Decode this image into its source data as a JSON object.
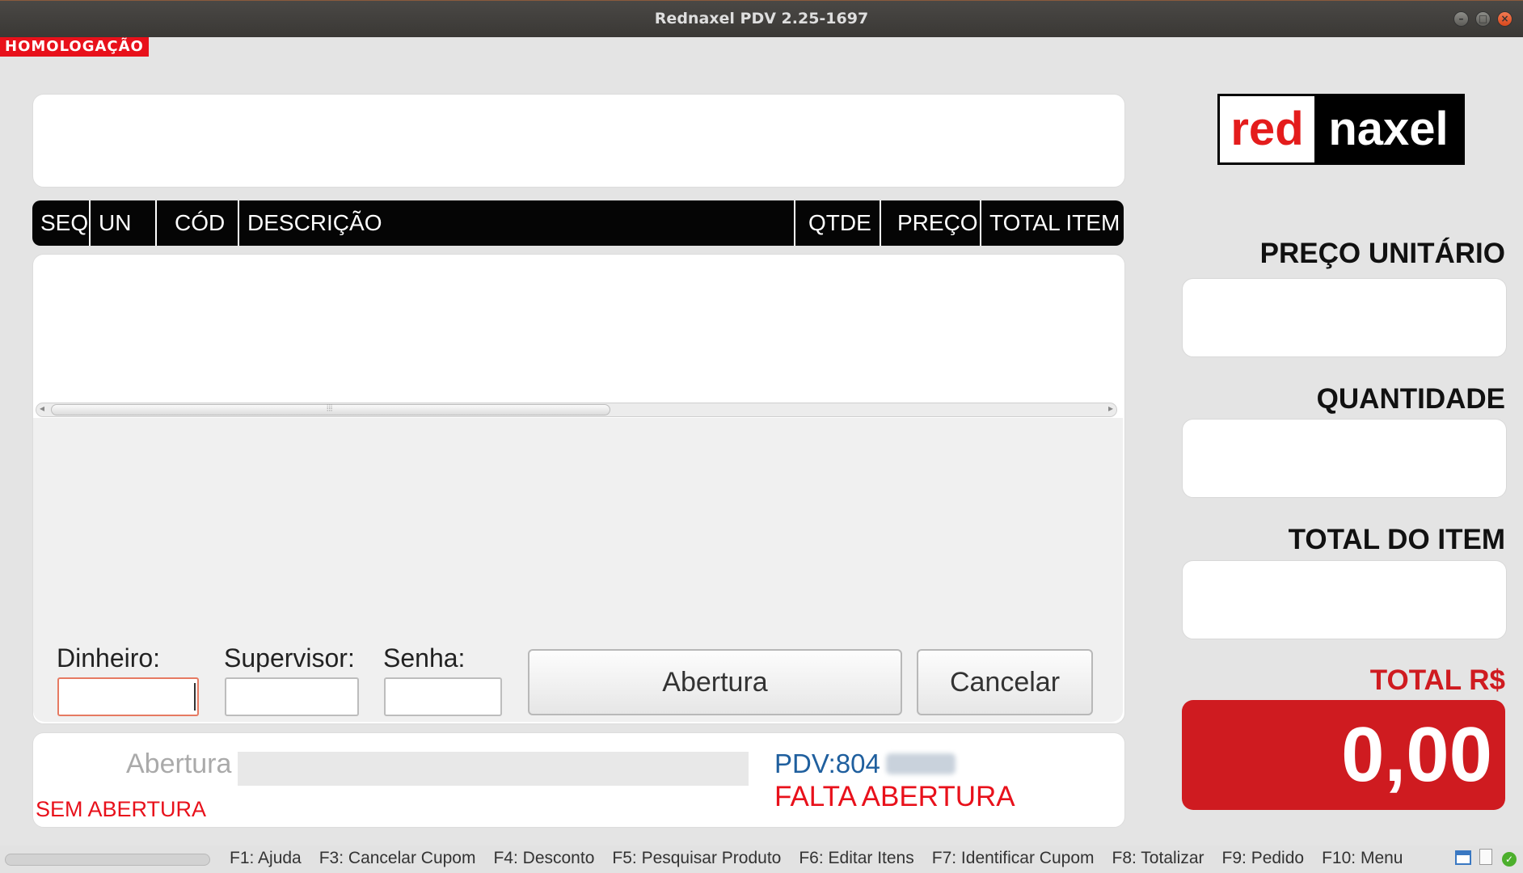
{
  "window": {
    "title": "Rednaxel PDV 2.25-1697"
  },
  "environment_badge": "HOMOLOGAÇÃO",
  "table": {
    "columns": [
      "SEQ",
      "UN",
      "CÓD",
      "DESCRIÇÃO",
      "QTDE",
      "PREÇO",
      "TOTAL ITEM"
    ],
    "rows": []
  },
  "form": {
    "dinheiro_label": "Dinheiro:",
    "dinheiro_value": "",
    "supervisor_label": "Supervisor:",
    "supervisor_value": "",
    "senha_label": "Senha:",
    "senha_value": "",
    "abertura_button": "Abertura",
    "cancelar_button": "Cancelar"
  },
  "status_panel": {
    "operation_label": "Abertura",
    "operation_value": "",
    "state_text": "SEM ABERTURA",
    "pdv_label": "PDV:804",
    "pdv_status": "FALTA ABERTURA"
  },
  "logo": {
    "part1": "red",
    "part2": "naxel"
  },
  "side": {
    "preco_unitario_label": "PREÇO UNITÁRIO",
    "preco_unitario_value": "",
    "quantidade_label": "QUANTIDADE",
    "quantidade_value": "",
    "total_do_item_label": "TOTAL DO ITEM",
    "total_do_item_value": "",
    "total_label": "TOTAL R$",
    "total_value": "0,00"
  },
  "footer": {
    "shortcuts": [
      "F1: Ajuda",
      "F3: Cancelar Cupom",
      "F4: Desconto",
      "F5: Pesquisar Produto",
      "F6: Editar Itens",
      "F7: Identificar Cupom",
      "F8: Totalizar",
      "F9: Pedido",
      "F10: Menu"
    ]
  },
  "colors": {
    "accent_red": "#cf1b20",
    "status_red": "#e8111b",
    "pdv_blue": "#1f5f9e",
    "header_black": "#050505"
  }
}
